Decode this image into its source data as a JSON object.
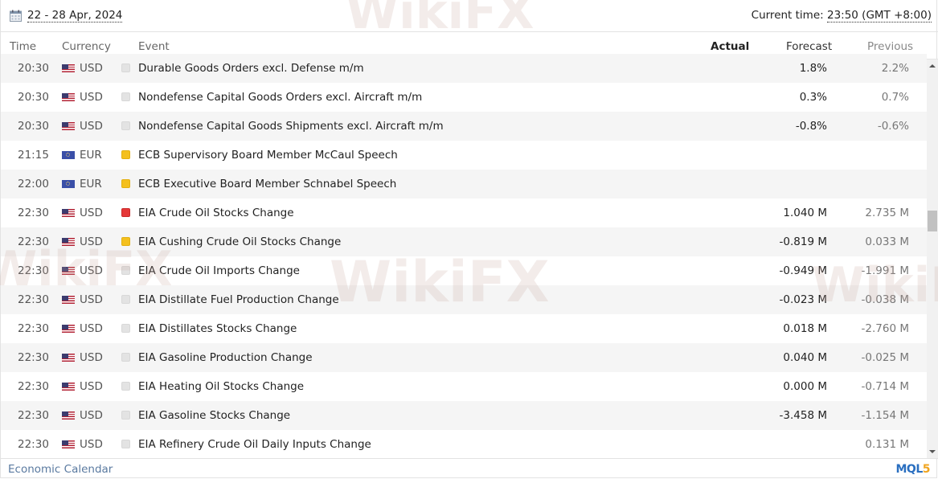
{
  "header": {
    "date_range": "22 - 28 Apr, 2024",
    "current_time_label": "Current time: ",
    "current_time_value": "23:50 (GMT +8:00)"
  },
  "columns": {
    "time": "Time",
    "currency": "Currency",
    "event": "Event",
    "actual": "Actual",
    "forecast": "Forecast",
    "previous": "Previous"
  },
  "importance_colors": {
    "none": "#e3e3e3",
    "medium": "#f4c01e",
    "high": "#e53838"
  },
  "rows": [
    {
      "time": "20:30",
      "currency": "USD",
      "flag": "us-flag-icon",
      "importance": "none",
      "event": "Durable Goods Orders excl. Defense m/m",
      "actual": "",
      "forecast": "1.8%",
      "previous": "2.2%"
    },
    {
      "time": "20:30",
      "currency": "USD",
      "flag": "us-flag-icon",
      "importance": "none",
      "event": "Nondefense Capital Goods Orders excl. Aircraft m/m",
      "actual": "",
      "forecast": "0.3%",
      "previous": "0.7%"
    },
    {
      "time": "20:30",
      "currency": "USD",
      "flag": "us-flag-icon",
      "importance": "none",
      "event": "Nondefense Capital Goods Shipments excl. Aircraft m/m",
      "actual": "",
      "forecast": "-0.8%",
      "previous": "-0.6%"
    },
    {
      "time": "21:15",
      "currency": "EUR",
      "flag": "eu-flag-icon",
      "importance": "medium",
      "event": "ECB Supervisory Board Member McCaul Speech",
      "actual": "",
      "forecast": "",
      "previous": ""
    },
    {
      "time": "22:00",
      "currency": "EUR",
      "flag": "eu-flag-icon",
      "importance": "medium",
      "event": "ECB Executive Board Member Schnabel Speech",
      "actual": "",
      "forecast": "",
      "previous": ""
    },
    {
      "time": "22:30",
      "currency": "USD",
      "flag": "us-flag-icon",
      "importance": "high",
      "event": "EIA Crude Oil Stocks Change",
      "actual": "",
      "forecast": "1.040 M",
      "previous": "2.735 M"
    },
    {
      "time": "22:30",
      "currency": "USD",
      "flag": "us-flag-icon",
      "importance": "medium",
      "event": "EIA Cushing Crude Oil Stocks Change",
      "actual": "",
      "forecast": "-0.819 M",
      "previous": "0.033 M"
    },
    {
      "time": "22:30",
      "currency": "USD",
      "flag": "us-flag-icon",
      "importance": "none",
      "event": "EIA Crude Oil Imports Change",
      "actual": "",
      "forecast": "-0.949 M",
      "previous": "-1.991 M"
    },
    {
      "time": "22:30",
      "currency": "USD",
      "flag": "us-flag-icon",
      "importance": "none",
      "event": "EIA Distillate Fuel Production Change",
      "actual": "",
      "forecast": "-0.023 M",
      "previous": "-0.038 M"
    },
    {
      "time": "22:30",
      "currency": "USD",
      "flag": "us-flag-icon",
      "importance": "none",
      "event": "EIA Distillates Stocks Change",
      "actual": "",
      "forecast": "0.018 M",
      "previous": "-2.760 M"
    },
    {
      "time": "22:30",
      "currency": "USD",
      "flag": "us-flag-icon",
      "importance": "none",
      "event": "EIA Gasoline Production Change",
      "actual": "",
      "forecast": "0.040 M",
      "previous": "-0.025 M"
    },
    {
      "time": "22:30",
      "currency": "USD",
      "flag": "us-flag-icon",
      "importance": "none",
      "event": "EIA Heating Oil Stocks Change",
      "actual": "",
      "forecast": "0.000 M",
      "previous": "-0.714 M"
    },
    {
      "time": "22:30",
      "currency": "USD",
      "flag": "us-flag-icon",
      "importance": "none",
      "event": "EIA Gasoline Stocks Change",
      "actual": "",
      "forecast": "-3.458 M",
      "previous": "-1.154 M"
    },
    {
      "time": "22:30",
      "currency": "USD",
      "flag": "us-flag-icon",
      "importance": "none",
      "event": "EIA Refinery Crude Oil Daily Inputs Change",
      "actual": "",
      "forecast": "",
      "previous": "0.131 M"
    }
  ],
  "footer": {
    "link": "Economic Calendar",
    "logo_main": "MQL",
    "logo_accent": "5"
  },
  "watermark": "WikiFX"
}
